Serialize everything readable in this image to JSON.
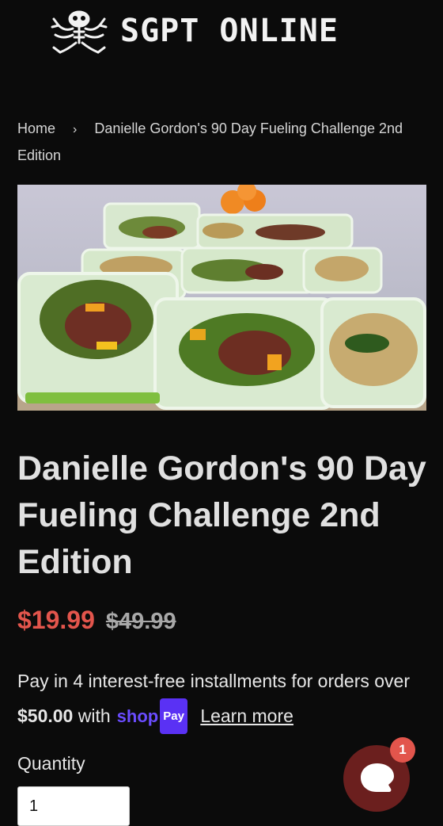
{
  "header": {
    "brand": "SGPT ONLINE",
    "logo_icon": "frog-skeleton-logo"
  },
  "breadcrumb": {
    "home": "Home",
    "separator": "›",
    "current": "Danielle Gordon's 90 Day Fueling Challenge 2nd Edition"
  },
  "product": {
    "image_icon": "meal-prep-containers-photo",
    "title": "Danielle Gordon's 90 Day Fueling Challenge 2nd Edition",
    "price": "$19.99",
    "compare_price": "$49.99",
    "installments_text_1": "Pay in 4 interest-free installments for orders over",
    "installments_threshold": "$50.00",
    "installments_text_2": "with",
    "shop_pay_word": "shop",
    "shop_pay_badge": "Pay",
    "learn_more": "Learn more",
    "quantity_label": "Quantity",
    "quantity_value": "1"
  },
  "chat": {
    "badge_count": "1",
    "icon": "chat-bubble-icon"
  },
  "colors": {
    "background": "#0b0b0b",
    "sale_price": "#e2554c",
    "shop_pay": "#5a31f4",
    "chat_button": "#6b1f1e"
  }
}
